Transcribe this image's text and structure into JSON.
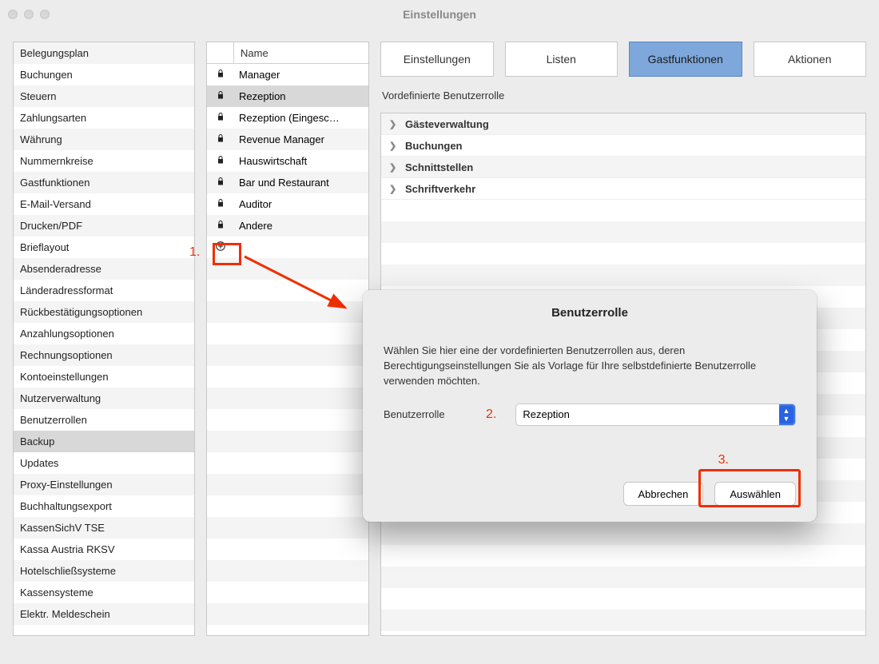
{
  "window": {
    "title": "Einstellungen"
  },
  "sidebar": {
    "selected_index": 18,
    "items": [
      "Belegungsplan",
      "Buchungen",
      "Steuern",
      "Zahlungsarten",
      "Währung",
      "Nummernkreise",
      "Gastfunktionen",
      "E-Mail-Versand",
      "Drucken/PDF",
      "Brieflayout",
      "Absenderadresse",
      "Länderadressformat",
      "Rückbestätigungsoptionen",
      "Anzahlungsoptionen",
      "Rechnungsoptionen",
      "Kontoeinstellungen",
      "Nutzerverwaltung",
      "Benutzerrollen",
      "Backup",
      "Updates",
      "Proxy-Einstellungen",
      "Buchhaltungsexport",
      "KassenSichV TSE",
      "Kassa Austria RKSV",
      "Hotelschließsysteme",
      "Kassensysteme",
      "Elektr. Meldeschein"
    ]
  },
  "roles": {
    "header": "Name",
    "selected_index": 1,
    "items": [
      "Manager",
      "Rezeption",
      "Rezeption (Eingesc…",
      "Revenue Manager",
      "Hauswirtschaft",
      "Bar und Restaurant",
      "Auditor",
      "Andere"
    ],
    "add_icon": "plus-circle"
  },
  "tabs": {
    "active_index": 2,
    "items": [
      "Einstellungen",
      "Listen",
      "Gastfunktionen",
      "Aktionen"
    ]
  },
  "subtitle": "Vordefinierte Benutzerrolle",
  "categories": [
    "Gästeverwaltung",
    "Buchungen",
    "Schnittstellen",
    "Schriftverkehr"
  ],
  "annotations": {
    "step1": "1.",
    "step2": "2.",
    "step3": "3."
  },
  "dialog": {
    "title": "Benutzerrolle",
    "text": "Wählen Sie hier eine der vordefinierten Benutzerrollen aus, deren Berechtigungseinstellungen Sie als Vorlage für Ihre selbstdefinierte Benutzerrolle verwenden möchten.",
    "label": "Benutzerrolle",
    "value": "Rezeption",
    "cancel": "Abbrechen",
    "confirm": "Auswählen"
  }
}
